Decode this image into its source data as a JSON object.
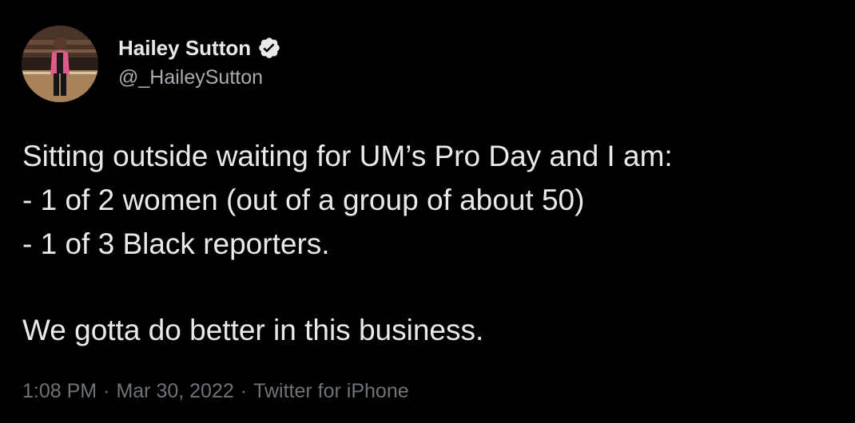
{
  "author": {
    "display_name": "Hailey Sutton",
    "handle": "@_HaileySutton",
    "verified": true
  },
  "icons": {
    "verified": "verified-badge-icon",
    "avatar": "profile-photo"
  },
  "tweet": {
    "lines": [
      "Sitting outside waiting for UM’s Pro Day and I am:",
      "- 1 of 2 women (out of a group of about 50)",
      "- 1 of 3 Black reporters.",
      "",
      "We gotta do better in this business."
    ]
  },
  "meta": {
    "time": "1:08 PM",
    "separator": "·",
    "date": "Mar 30, 2022",
    "source": "Twitter for iPhone"
  },
  "colors": {
    "background": "#000000",
    "text": "#e7e9ea",
    "handle": "#a9adb1",
    "meta": "#6e7378",
    "verified_badge": "#e7e9ea"
  }
}
